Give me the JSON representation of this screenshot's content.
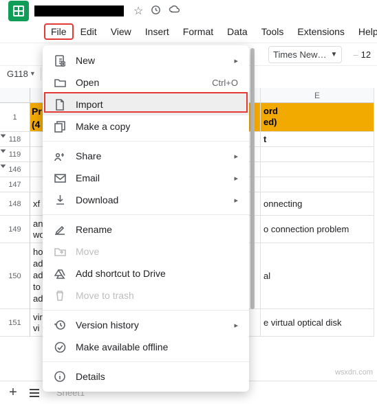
{
  "header": {
    "doc_title_blackbox": "",
    "star_icon": "star",
    "history_icon": "history",
    "cloud_icon": "cloud"
  },
  "menubar": {
    "file": "File",
    "edit": "Edit",
    "view": "View",
    "insert": "Insert",
    "format": "Format",
    "data": "Data",
    "tools": "Tools",
    "extensions": "Extensions",
    "help": "Help"
  },
  "toolbar": {
    "font_name": "Times New…",
    "font_size": "12"
  },
  "namebox": {
    "ref": "G118"
  },
  "columns": {
    "e": "E"
  },
  "sheet_header": {
    "left_line1": "Pr",
    "left_line2": "(4",
    "right_line1": "ord",
    "right_line2": "ed)"
  },
  "rows": {
    "r118": {
      "num": "118",
      "val_e": "t"
    },
    "r119": {
      "num": "119",
      "val_e": ""
    },
    "r146": {
      "num": "146",
      "val_e": ""
    },
    "r147": {
      "num": "147",
      "val_e": ""
    },
    "r148": {
      "num": "148",
      "a": "xf",
      "val_e": "onnecting"
    },
    "r149": {
      "num": "149",
      "a": "an\nwo",
      "val_e": "o connection problem"
    },
    "r150": {
      "num": "150",
      "a": "ho\nad\nad\nto\nad",
      "val_e": "al"
    },
    "r151": {
      "num": "151",
      "a": "vir\nvi",
      "val_e": "e virtual optical disk"
    }
  },
  "file_menu": {
    "new": "New",
    "open": "Open",
    "open_shortcut": "Ctrl+O",
    "import": "Import",
    "make_copy": "Make a copy",
    "share": "Share",
    "email": "Email",
    "download": "Download",
    "rename": "Rename",
    "move": "Move",
    "add_shortcut": "Add shortcut to Drive",
    "move_trash": "Move to trash",
    "version_history": "Version history",
    "offline": "Make available offline",
    "details": "Details"
  },
  "bottom": {
    "sheet1": "Sheet1"
  },
  "watermark": "wsxdn.com"
}
